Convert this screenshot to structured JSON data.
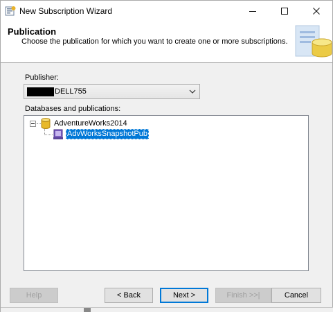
{
  "window": {
    "title": "New Subscription Wizard",
    "minimize_glyph": "—",
    "maximize_glyph": "☐",
    "close_glyph": "✕"
  },
  "header": {
    "title": "Publication",
    "subtitle": "Choose the publication for which you want to create one or more subscriptions."
  },
  "publisher": {
    "label": "Publisher:",
    "value": "DELL755",
    "value_prefix_redacted": true
  },
  "databases": {
    "label": "Databases and publications:",
    "tree": [
      {
        "name": "AdventureWorks2014",
        "expanded": true,
        "icon": "database-icon",
        "children": [
          {
            "name": "AdvWorksSnapshotPub",
            "icon": "publication-icon",
            "selected": true
          }
        ]
      }
    ]
  },
  "buttons": {
    "help": "Help",
    "back": "< Back",
    "next": "Next >",
    "finish": "Finish >>|",
    "cancel": "Cancel"
  },
  "colors": {
    "selection": "#0078d7",
    "dialog_bg": "#f0f0f0",
    "header_bg": "#ffffff"
  }
}
